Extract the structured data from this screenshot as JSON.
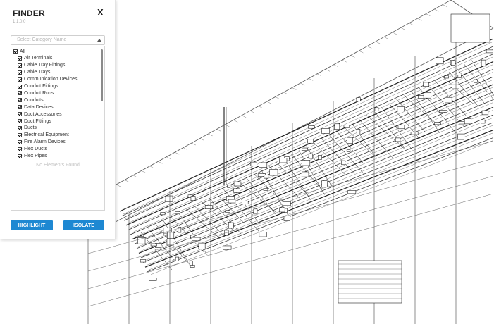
{
  "finder": {
    "title": "FINDER",
    "version": "1.1.0.0",
    "close_label": "X",
    "category_placeholder": "Select Category Name",
    "categories": [
      {
        "label": "All",
        "checked": true
      },
      {
        "label": "Air Terminals",
        "checked": true
      },
      {
        "label": "Cable Tray Fittings",
        "checked": true
      },
      {
        "label": "Cable Trays",
        "checked": true
      },
      {
        "label": "Communication Devices",
        "checked": true
      },
      {
        "label": "Conduit Fittings",
        "checked": true
      },
      {
        "label": "Conduit Runs",
        "checked": true
      },
      {
        "label": "Conduits",
        "checked": true
      },
      {
        "label": "Data Devices",
        "checked": true
      },
      {
        "label": "Duct Accessories",
        "checked": true
      },
      {
        "label": "Duct Fittings",
        "checked": true
      },
      {
        "label": "Ducts",
        "checked": true
      },
      {
        "label": "Electrical Equipment",
        "checked": true
      },
      {
        "label": "Fire Alarm Devices",
        "checked": true
      },
      {
        "label": "Flex Ducts",
        "checked": true
      },
      {
        "label": "Flex Pipes",
        "checked": true
      }
    ],
    "empty_message": "No Elements Found",
    "highlight_label": "HIGHLIGHT",
    "isolate_label": "ISOLATE",
    "accent_color": "#1e88d2"
  }
}
